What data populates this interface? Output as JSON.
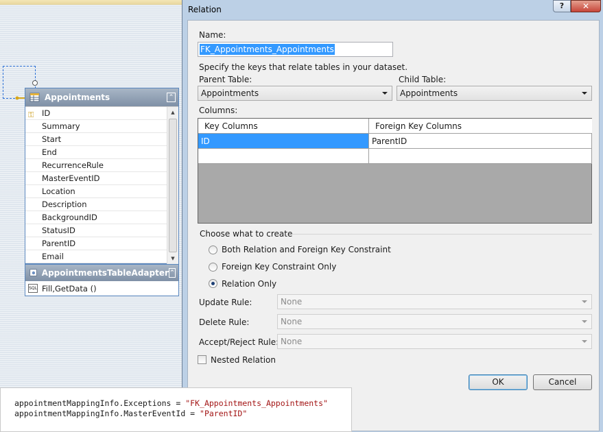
{
  "designer": {
    "table": {
      "title": "Appointments",
      "fields": [
        "ID",
        "Summary",
        "Start",
        "End",
        "RecurrenceRule",
        "MasterEventID",
        "Location",
        "Description",
        "BackgroundID",
        "StatusID",
        "ParentID",
        "Email"
      ],
      "adapter_title": "AppointmentsTableAdapter",
      "adapter_method": "Fill,GetData ()"
    }
  },
  "dialog": {
    "title": "Relation",
    "help_label": "?",
    "close_label": "✕",
    "name_label": "Name:",
    "name_value": "FK_Appointments_Appointments",
    "keys_hint": "Specify the keys that relate tables in your dataset.",
    "parent_table_label": "Parent Table:",
    "parent_table_value": "Appointments",
    "child_table_label": "Child Table:",
    "child_table_value": "Appointments",
    "columns_label": "Columns:",
    "grid": {
      "headers": [
        "Key Columns",
        "Foreign Key Columns"
      ],
      "rows": [
        [
          "ID",
          "ParentID"
        ],
        [
          "",
          ""
        ]
      ]
    },
    "create_group_label": "Choose what to create",
    "options": [
      "Both Relation and Foreign Key Constraint",
      "Foreign Key Constraint Only",
      "Relation Only"
    ],
    "selected_option": "Relation Only",
    "update_rule_label": "Update Rule:",
    "update_rule_value": "None",
    "delete_rule_label": "Delete Rule:",
    "delete_rule_value": "None",
    "accept_reject_label": "Accept/Reject Rule:",
    "accept_reject_value": "None",
    "nested_relation_label": "Nested Relation",
    "nested_relation_checked": false,
    "ok_label": "OK",
    "cancel_label": "Cancel"
  },
  "code": {
    "line1_prefix": "appointmentMappingInfo.Exceptions = ",
    "line1_value": "\"FK_Appointments_Appointments\"",
    "line2_prefix": "appointmentMappingInfo.MasterEventId = ",
    "line2_value": "\"ParentID\""
  },
  "colors": {
    "selection": "#3399ff",
    "title_gradient_top": "#a8b6c6",
    "close_button": "#c7463a"
  }
}
